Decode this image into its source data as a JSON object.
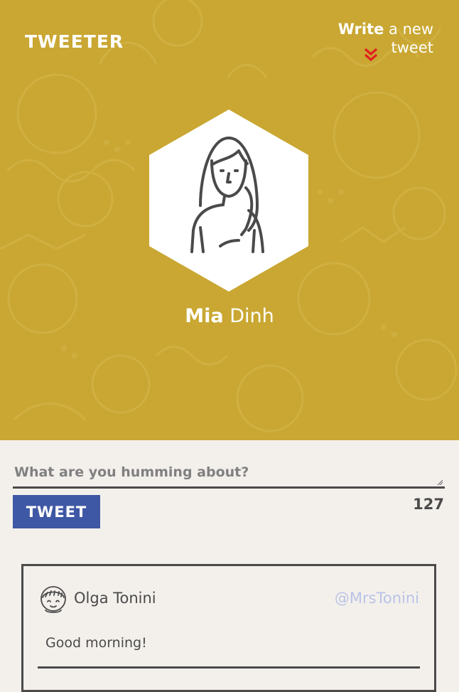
{
  "header": {
    "brand": "TWEETER",
    "write_link": {
      "bold": "Write",
      "rest": " a new tweet"
    },
    "background_color": "#c9a732"
  },
  "profile": {
    "first_name": "Mia",
    "last_name": "Dinh",
    "avatar_icon": "woman-avatar-icon"
  },
  "compose": {
    "placeholder": "What are you humming about?",
    "value": "",
    "button_label": "TWEET",
    "char_count": "127",
    "button_color": "#3f58a5"
  },
  "tweets": [
    {
      "author": "Olga Tonini",
      "handle": "@MrsTonini",
      "text": "Good morning!",
      "avatar_icon": "girl-avatar-icon"
    }
  ]
}
